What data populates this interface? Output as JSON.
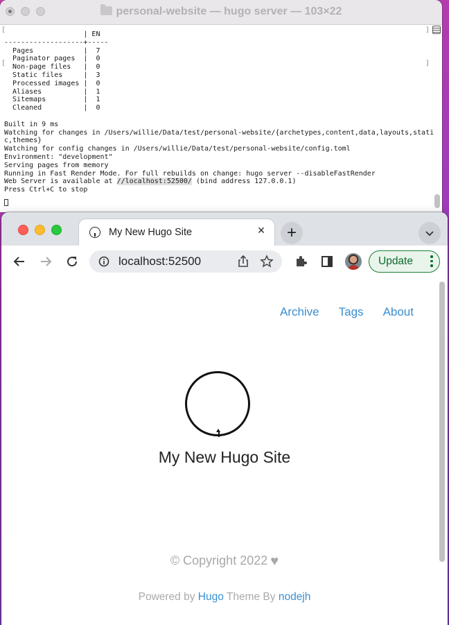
{
  "terminal": {
    "title": "personal-website — hugo server — 103×22",
    "lines": [
      "                   | EN",
      "-------------------+-----",
      "  Pages            |  7",
      "  Paginator pages  |  0",
      "  Non-page files   |  0",
      "  Static files     |  3",
      "  Processed images |  0",
      "  Aliases          |  1",
      "  Sitemaps         |  1",
      "  Cleaned          |  0",
      "",
      "Built in 9 ms",
      "Watching for changes in /Users/willie/Data/test/personal-website/{archetypes,content,data,layouts,stati",
      "c,themes}",
      "Watching for config changes in /Users/willie/Data/test/personal-website/config.toml",
      "Environment: \"development\"",
      "Serving pages from memory",
      "Running in Fast Render Mode. For full rebuilds on change: hugo server --disableFastRender"
    ],
    "server_prefix": "Web Server is available at",
    "server_link": "//localhost:52500/",
    "server_suffix": "(bind address 127.0.0.1)",
    "stop_line": "Press Ctrl+C to stop"
  },
  "browser": {
    "tab_title": "My New Hugo Site",
    "tab_close": "×",
    "new_tab": "+",
    "url": "localhost:52500",
    "update_label": "Update"
  },
  "site": {
    "nav": [
      "Archive",
      "Tags",
      "About"
    ],
    "title": "My New Hugo Site",
    "copyright": "© Copyright 2022",
    "powered_prefix": "Powered by",
    "powered_hugo": "Hugo",
    "powered_middle": "Theme By",
    "powered_author": "nodejh"
  },
  "colors": {
    "link": "#3a8fd1",
    "update_green": "#1a7f37"
  }
}
